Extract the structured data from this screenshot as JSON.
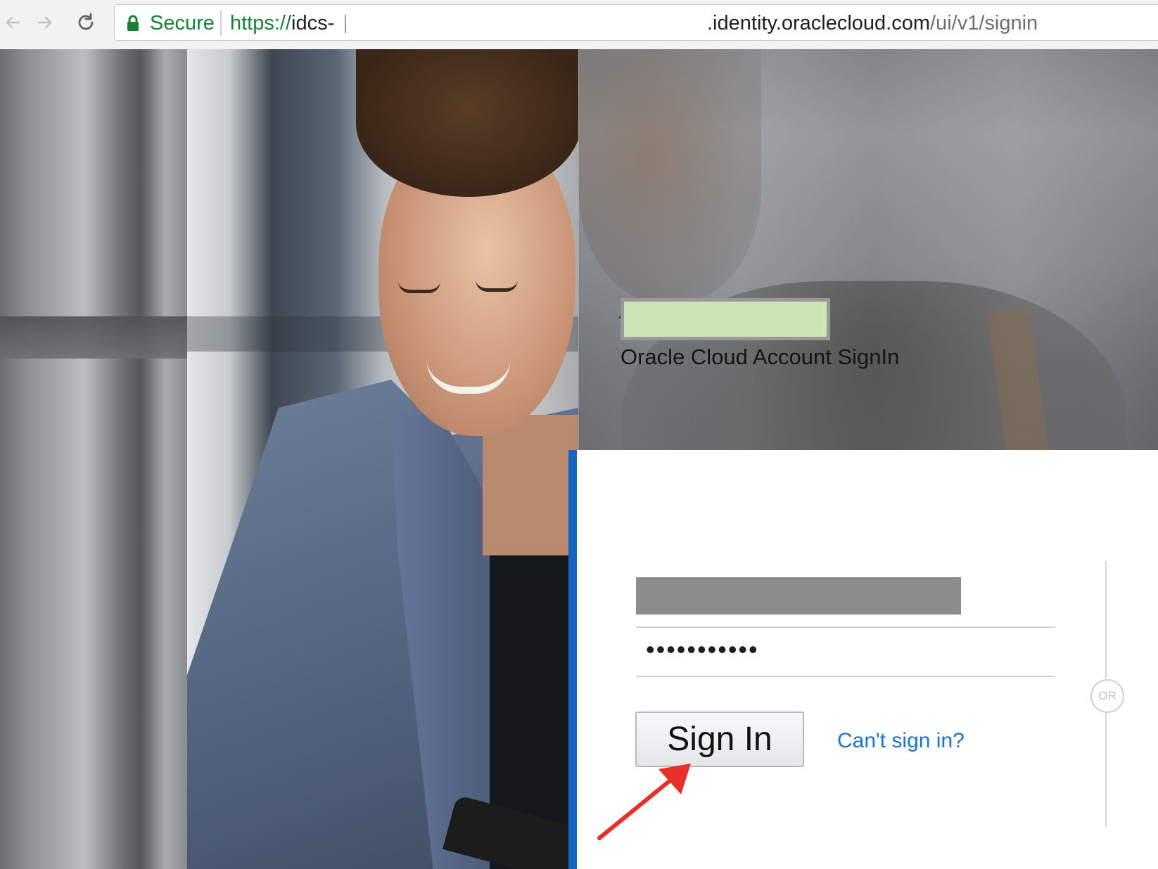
{
  "browser": {
    "secure_label": "Secure",
    "url": {
      "scheme": "https://",
      "host_start": "idcs-",
      "host_end": ".identity.oraclecloud.com",
      "path": "/ui/v1/signin"
    },
    "icons": [
      "back-arrow-icon",
      "forward-arrow-icon",
      "reload-icon",
      "lock-icon"
    ],
    "secure_color": "#188038"
  },
  "header": {
    "title": "Oracle Cloud Account SignIn",
    "logo_color": "#cbe6b4"
  },
  "form": {
    "username_value": "",
    "password_value": "•••••••••••",
    "signin_label": "Sign In",
    "cant_signin_label": "Can't sign in?",
    "or_label": "OR",
    "accent_color": "#1565c0",
    "link_color": "#1a73c8"
  }
}
